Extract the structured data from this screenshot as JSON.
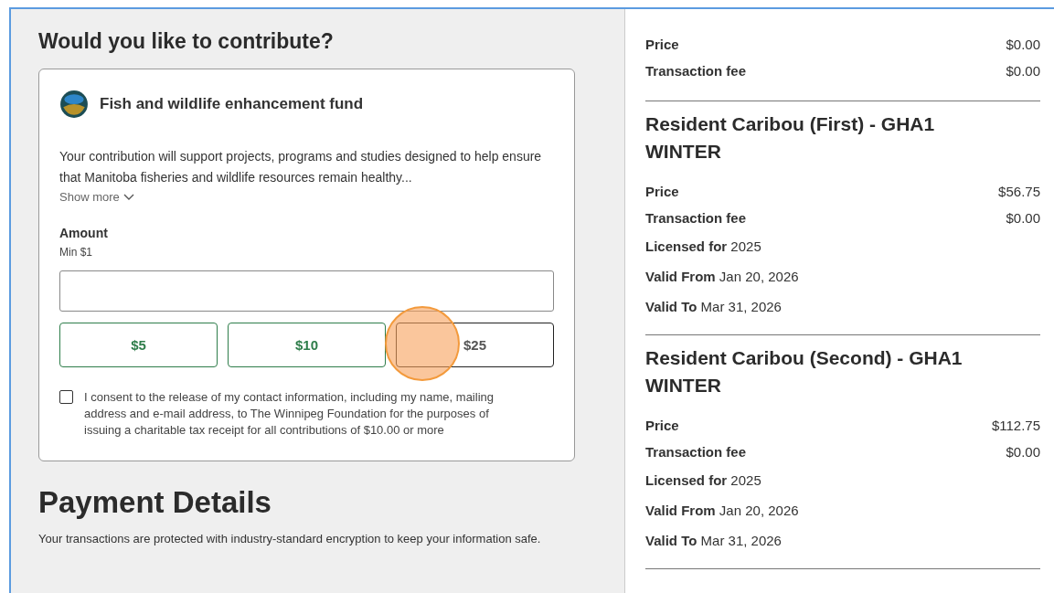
{
  "contribute": {
    "title": "Would you like to contribute?",
    "fund": {
      "name": "Fish and wildlife enhancement fund",
      "description": "Your contribution will support projects, programs and studies designed to help ensure that Manitoba fisheries and wildlife resources remain healthy...",
      "show_more": "Show more"
    },
    "amount": {
      "label": "Amount",
      "hint": "Min $1"
    },
    "presets": [
      {
        "label": "$5",
        "selected": false
      },
      {
        "label": "$10",
        "selected": false
      },
      {
        "label": "$25",
        "selected": true
      }
    ],
    "consent": {
      "text": "I consent to the release of my contact information, including my name, mailing address and e-mail address, to The Winnipeg Foundation for the purposes of issuing a charitable tax receipt for all contributions of $10.00 or more",
      "checked": false
    }
  },
  "payment": {
    "title": "Payment Details",
    "note": "Your transactions are protected with industry-standard encryption to keep your information safe."
  },
  "summary": [
    {
      "rows": [
        {
          "label": "Price",
          "value": "$0.00"
        },
        {
          "label": "Transaction fee",
          "value": "$0.00"
        }
      ]
    },
    {
      "title": "Resident Caribou (First) - GHA1 WINTER",
      "rows": [
        {
          "label": "Price",
          "value": "$56.75"
        },
        {
          "label": "Transaction fee",
          "value": "$0.00"
        }
      ],
      "details": [
        {
          "label": "Licensed for",
          "value": "2025"
        },
        {
          "label": "Valid From",
          "value": "Jan 20, 2026"
        },
        {
          "label": "Valid To",
          "value": "Mar 31, 2026"
        }
      ]
    },
    {
      "title": "Resident Caribou (Second) - GHA1 WINTER",
      "rows": [
        {
          "label": "Price",
          "value": "$112.75"
        },
        {
          "label": "Transaction fee",
          "value": "$0.00"
        }
      ],
      "details": [
        {
          "label": "Licensed for",
          "value": "2025"
        },
        {
          "label": "Valid From",
          "value": "Jan 20, 2026"
        },
        {
          "label": "Valid To",
          "value": "Mar 31, 2026"
        }
      ]
    }
  ]
}
